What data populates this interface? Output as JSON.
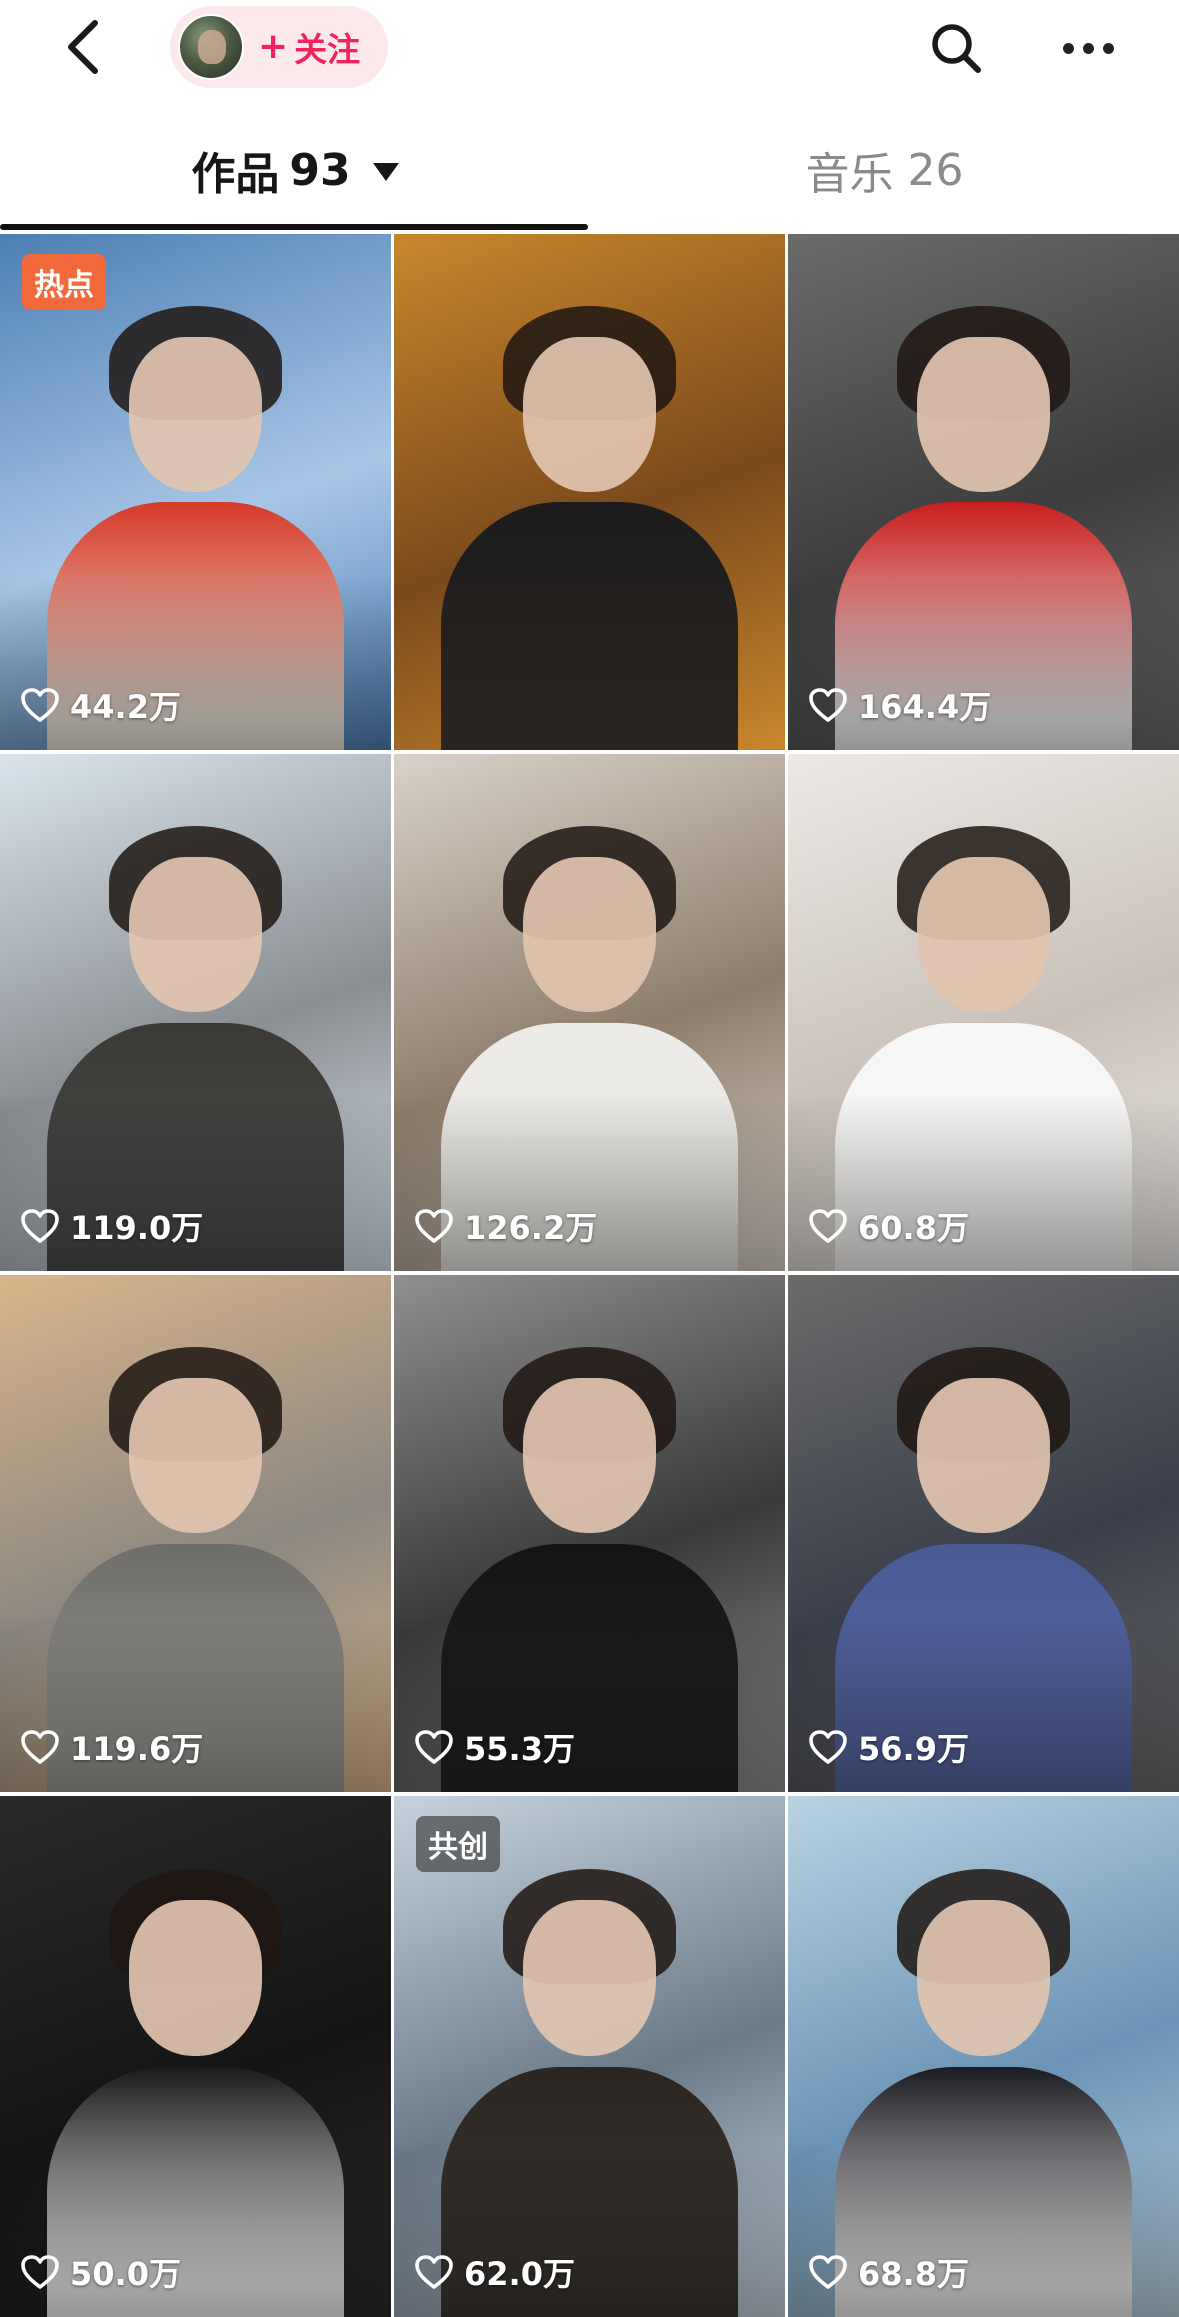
{
  "header": {
    "follow_label": "关注",
    "follow_plus": "+",
    "icons": [
      "back-arrow-icon",
      "search-icon",
      "more-dots-icon"
    ]
  },
  "tabs": {
    "works": {
      "label": "作品",
      "count": "93",
      "active": true
    },
    "music": {
      "label": "音乐",
      "count": "26",
      "active": false
    }
  },
  "videos": [
    {
      "likes": "44.2万",
      "badge": "热点",
      "palette": [
        "#4d7fb3",
        "#a8c6e6",
        "#e9e2d6",
        "#d63a2a"
      ]
    },
    {
      "likes": "",
      "badge": "",
      "palette": [
        "#c9872c",
        "#7a4a1c",
        "#2a2420",
        "#1c1c1c"
      ]
    },
    {
      "likes": "164.4万",
      "badge": "",
      "palette": [
        "#6b6b6b",
        "#3d3d3d",
        "#eeeeee",
        "#c81e1e"
      ]
    },
    {
      "likes": "119.0万",
      "badge": "",
      "palette": [
        "#d9e4ec",
        "#8a8e92",
        "#4b4b4b",
        "#3b3a36"
      ]
    },
    {
      "likes": "126.2万",
      "badge": "",
      "palette": [
        "#d9d2c9",
        "#8f7d6b",
        "#e8e6e1",
        "#ecebe7"
      ]
    },
    {
      "likes": "60.8万",
      "badge": "",
      "palette": [
        "#ece9e6",
        "#c9c1b9",
        "#f4f3f1",
        "#f7f7f7"
      ]
    },
    {
      "likes": "119.6万",
      "badge": "",
      "palette": [
        "#d8b48a",
        "#8c8780",
        "#9a9894",
        "#6f6d69"
      ]
    },
    {
      "likes": "55.3万",
      "badge": "",
      "palette": [
        "#8f8f8f",
        "#3a3a3a",
        "#222222",
        "#141414"
      ]
    },
    {
      "likes": "56.9万",
      "badge": "",
      "palette": [
        "#6b6b6b",
        "#3a3f4a",
        "#5566a0",
        "#4a5a94"
      ]
    },
    {
      "likes": "50.0万",
      "badge": "",
      "palette": [
        "#2a2a2a",
        "#141414",
        "#f1f1f1",
        "#1b1b1b"
      ]
    },
    {
      "likes": "62.0万",
      "badge": "共创",
      "palette": [
        "#c6d3df",
        "#6b7a88",
        "#3a3632",
        "#2b2622"
      ]
    },
    {
      "likes": "68.8万",
      "badge": "",
      "palette": [
        "#b9d3e2",
        "#6a93b5",
        "#eeeeee",
        "#1b1b22"
      ]
    }
  ]
}
